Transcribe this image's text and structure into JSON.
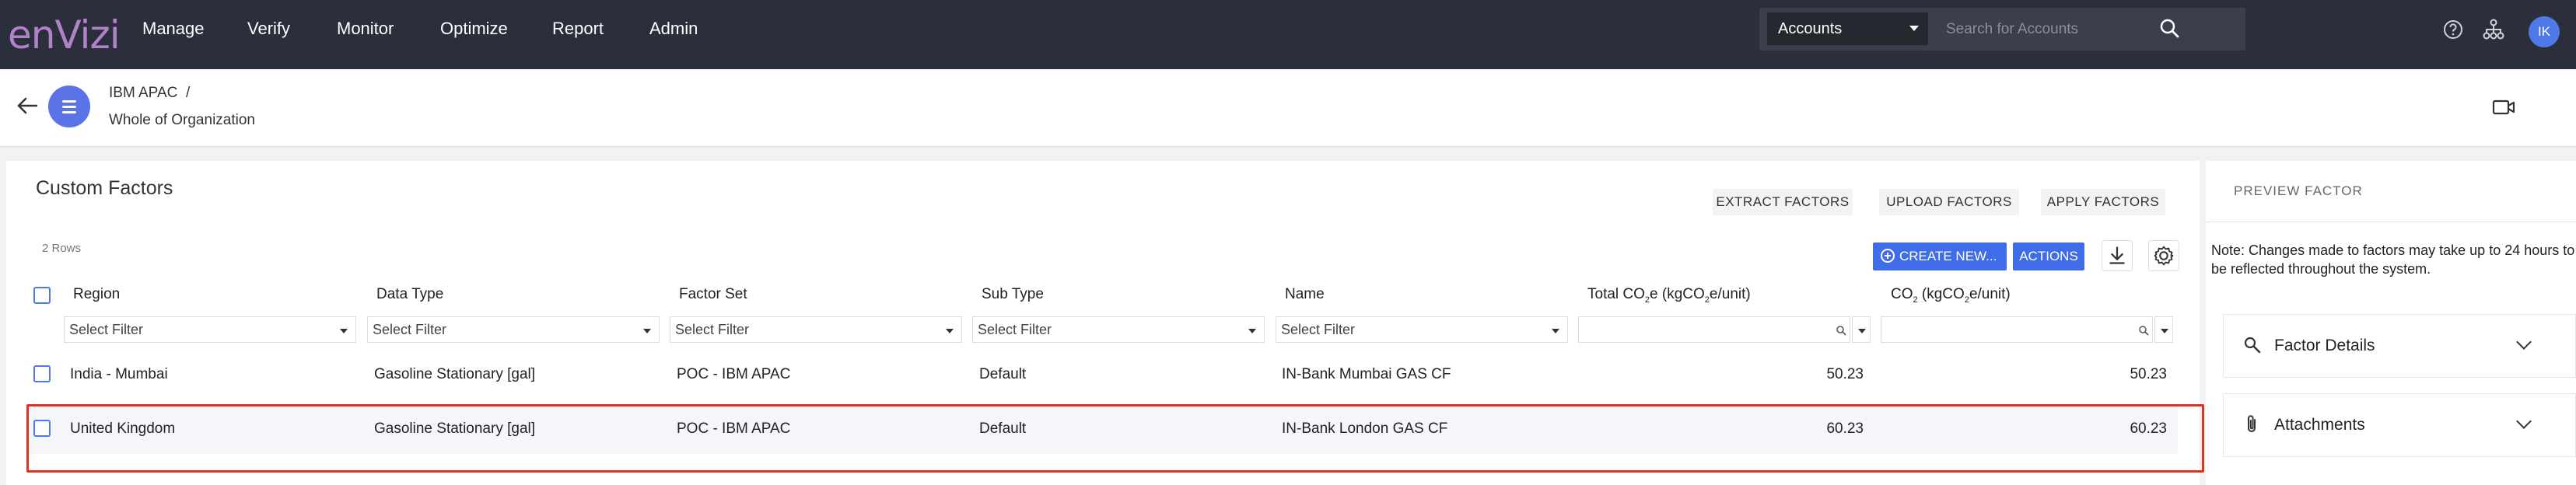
{
  "brand": {
    "logo_text": "enVizi"
  },
  "nav": {
    "items": [
      {
        "label": "Manage"
      },
      {
        "label": "Verify"
      },
      {
        "label": "Monitor"
      },
      {
        "label": "Optimize"
      },
      {
        "label": "Report"
      },
      {
        "label": "Admin"
      }
    ]
  },
  "search": {
    "scope": "Accounts",
    "placeholder": "Search for Accounts"
  },
  "user": {
    "initials": "IK"
  },
  "breadcrumb": {
    "parent": "IBM APAC",
    "separator": "/",
    "current": "Whole of Organization"
  },
  "main": {
    "title": "Custom Factors",
    "row_count": "2 Rows",
    "header_actions": {
      "extract": "EXTRACT FACTORS",
      "upload": "UPLOAD FACTORS",
      "apply": "APPLY FACTORS"
    },
    "create_new": "CREATE NEW...",
    "actions": "ACTIONS",
    "columns": {
      "region": "Region",
      "data_type": "Data Type",
      "factor_set": "Factor Set",
      "sub_type": "Sub Type",
      "name": "Name",
      "total_co2e_a": "Total CO",
      "total_co2e_sub1": "2",
      "total_co2e_b": "e (kgCO",
      "total_co2e_sub2": "2",
      "total_co2e_c": "e/unit)",
      "co2_a": "CO",
      "co2_sub1": "2",
      "co2_b": " (kgCO",
      "co2_sub2": "2",
      "co2_c": "e/unit)"
    },
    "filter_placeholder": "Select Filter",
    "rows": [
      {
        "region": "India - Mumbai",
        "data_type": "Gasoline Stationary [gal]",
        "factor_set": "POC - IBM APAC",
        "sub_type": "Default",
        "name": "IN-Bank Mumbai GAS CF",
        "total_co2e": "50.23",
        "co2": "50.23"
      },
      {
        "region": "United Kingdom",
        "data_type": "Gasoline Stationary [gal]",
        "factor_set": "POC - IBM APAC",
        "sub_type": "Default",
        "name": "IN-Bank London GAS CF",
        "total_co2e": "60.23",
        "co2": "60.23"
      }
    ]
  },
  "preview": {
    "title": "PREVIEW FACTOR",
    "note": "Note: Changes made to factors may take up to 24 hours to be reflected throughout the system.",
    "sections": {
      "factor_details": "Factor Details",
      "attachments": "Attachments"
    }
  },
  "colors": {
    "nav_bg": "#2b2f3b",
    "accent": "#3f6de8",
    "highlight": "#e2301f",
    "logo": "#b083c9"
  }
}
